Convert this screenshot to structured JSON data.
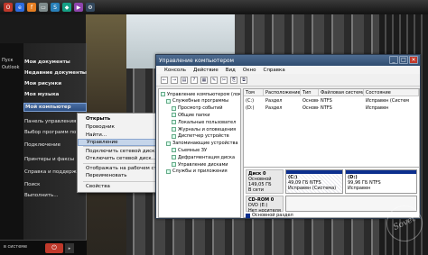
{
  "start_menu": {
    "left_texts": [
      "Пуск",
      "Outlook"
    ],
    "items": [
      {
        "label": "Мои документы",
        "bold": true
      },
      {
        "label": "Недавние документы",
        "bold": true,
        "arrow": true
      },
      {
        "label": "Мои рисунки",
        "bold": true
      },
      {
        "label": "Моя музыка",
        "bold": true
      },
      {
        "label": "Мой компьютер",
        "bold": true,
        "highlighted": true
      },
      {
        "label": "Панель управления"
      },
      {
        "label": "Выбор программ по умолчанию"
      },
      {
        "label": "Подключение"
      },
      {
        "label": "Принтеры и факсы"
      },
      {
        "label": "Справка и поддержка"
      },
      {
        "label": "Поиск"
      },
      {
        "label": "Выполнить..."
      }
    ],
    "bottom_label": "в системе",
    "power_glyph": "⏻",
    "arrow_glyph": "▸"
  },
  "context_menu": {
    "items": [
      {
        "label": "Открыть",
        "bold": true
      },
      {
        "label": "Проводник"
      },
      {
        "label": "Найти..."
      },
      {
        "label": "Управление",
        "highlighted": true
      },
      {
        "label": "Подключить сетевой диск..."
      },
      {
        "label": "Отключить сетевой диск..."
      },
      {
        "label": "Отображать на рабочем столе"
      },
      {
        "label": "Переименовать"
      },
      {
        "label": "Свойства"
      }
    ]
  },
  "window": {
    "title": "Управление компьютером",
    "title_buttons": [
      "_",
      "□",
      "✕"
    ],
    "menu": [
      "Консоль",
      "Действие",
      "Вид",
      "Окно",
      "Справка"
    ],
    "toolbar_icons": [
      "←",
      "→",
      "▤",
      "?",
      "▦",
      "✎",
      "✂",
      "⎘",
      "⧉"
    ],
    "tree": [
      {
        "label": "Управление компьютером (лока",
        "indent": 0
      },
      {
        "label": "Служебные программы",
        "indent": 1
      },
      {
        "label": "Просмотр событий",
        "indent": 2
      },
      {
        "label": "Общие папки",
        "indent": 2
      },
      {
        "label": "Локальные пользовател",
        "indent": 2
      },
      {
        "label": "Журналы и оповещения",
        "indent": 2
      },
      {
        "label": "Диспетчер устройств",
        "indent": 2
      },
      {
        "label": "Запоминающие устройства",
        "indent": 1
      },
      {
        "label": "Съемные ЗУ",
        "indent": 2
      },
      {
        "label": "Дефрагментация диска",
        "indent": 2
      },
      {
        "label": "Управление дисками",
        "indent": 2
      },
      {
        "label": "Службы и приложения",
        "indent": 1
      }
    ],
    "volume_headers": [
      "Том",
      "Расположение",
      "Тип",
      "Файловая система",
      "Состояние"
    ],
    "volumes": [
      [
        "(C:)",
        "Раздел",
        "Основной",
        "NTFS",
        "Исправен (Систем"
      ],
      [
        "(D:)",
        "Раздел",
        "Основной",
        "NTFS",
        "Исправен"
      ]
    ],
    "disks": [
      {
        "name": "Диск 0",
        "type": "Основной",
        "size": "149,05 ГБ",
        "status": "В сети"
      },
      {
        "name": "CD-ROM 0",
        "type": "DVD (E:)",
        "size": "",
        "status": "Нет носителя"
      }
    ],
    "partitions": [
      {
        "name": "(C:)",
        "size": "49,09 ГБ NTFS",
        "status": "Исправен (Система)"
      },
      {
        "name": "(D:)",
        "size": "99,96 ГБ NTFS",
        "status": "Исправен"
      }
    ],
    "legend": "Основной раздел"
  },
  "watermark": "Sovet",
  "colors": {
    "accent_blue": "#0c2f8e",
    "menu_highlight": "#c5d5ea"
  }
}
